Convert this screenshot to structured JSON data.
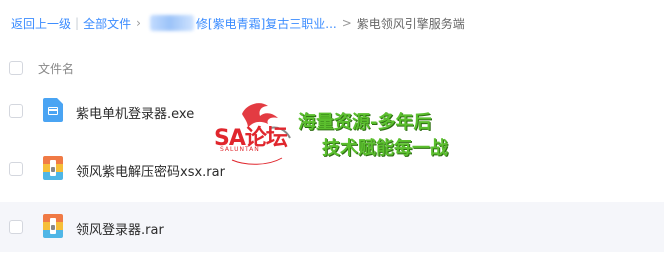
{
  "breadcrumb": {
    "back": "返回上一级",
    "all_files": "全部文件",
    "folder": "修[紫电青霜]复古三职业...",
    "current": "紫电领风引擎服务端"
  },
  "header": {
    "column_label": "文件名"
  },
  "files": [
    {
      "name": "紫电单机登录器.exe",
      "icon": "exe-file-icon"
    },
    {
      "name": "领风紫电解压密码xsx.rar",
      "icon": "rar-archive-icon"
    },
    {
      "name": "领风登录器.rar",
      "icon": "rar-archive-icon"
    }
  ],
  "watermark": {
    "logo_text": "SA论坛",
    "logo_sub": "SALUNTAN",
    "slogan_line1": "海量资源-多年后",
    "slogan_line2": "技术赋能每一战"
  }
}
